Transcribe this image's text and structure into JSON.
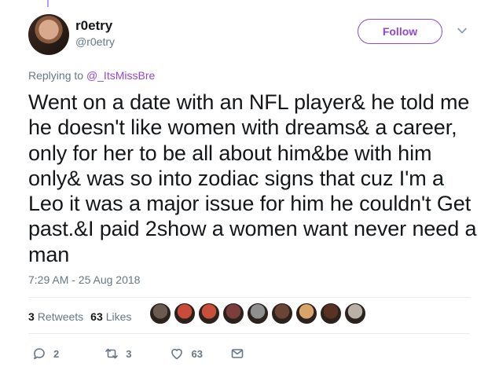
{
  "user": {
    "display_name": "r0etry",
    "handle": "@r0etry"
  },
  "follow_label": "Follow",
  "reply_context": {
    "prefix": "Replying to",
    "mention": "@_ItsMissBre"
  },
  "tweet_text": "Went on a date with an NFL player& he told me he doesn't like women with dreams& a career, only for her to be all about him&be with him only& was so into zodiac signs that cuz I'm a Leo it was a major issue for him he couldn't Get past.&I paid 2show a women want never need a man",
  "timestamp": "7:29 AM - 25 Aug 2018",
  "stats": {
    "retweets_count": "3",
    "retweets_label": "Retweets",
    "likes_count": "63",
    "likes_label": "Likes"
  },
  "likers": [
    {
      "color": "#6b5a50"
    },
    {
      "color": "#c94b3a"
    },
    {
      "color": "#c8503a"
    },
    {
      "color": "#7a3f3a"
    },
    {
      "color": "#8f8f8f"
    },
    {
      "color": "#6a4536"
    },
    {
      "color": "#d9a46a"
    },
    {
      "color": "#5a3224"
    },
    {
      "color": "#b9b0a8"
    }
  ],
  "actions": {
    "reply_count": "2",
    "retweet_count": "3",
    "like_count": "63"
  },
  "colors": {
    "accent": "#9146d4",
    "muted": "#657786",
    "text": "#14171a"
  }
}
